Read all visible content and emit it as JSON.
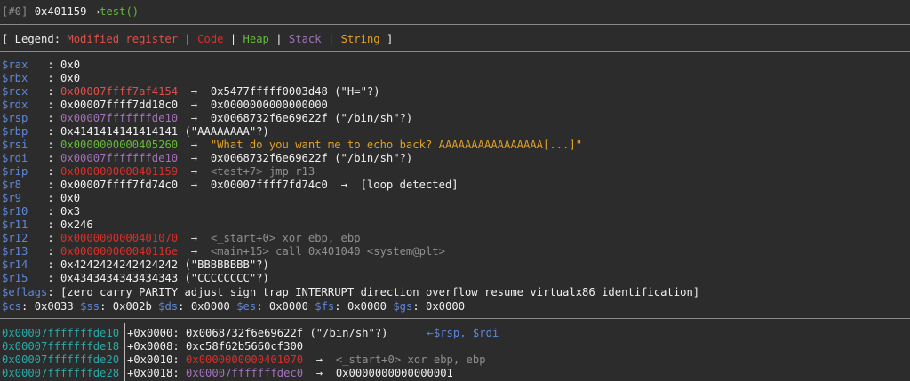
{
  "header": {
    "frame": "[#0]",
    "address": "0x401159",
    "arrow": "→",
    "func": "test()"
  },
  "legend": {
    "open": "[ Legend: ",
    "modified": "Modified register",
    "sep": " | ",
    "code": "Code",
    "heap": "Heap",
    "stack": "Stack",
    "string": "String",
    "close": " ]"
  },
  "registers": [
    {
      "name": "$rax",
      "colon": "   : ",
      "val": "0x0",
      "vclass": "w",
      "arrow1": "",
      "target": "",
      "tclass": "w",
      "extra": ""
    },
    {
      "name": "$rbx",
      "colon": "   : ",
      "val": "0x0",
      "vclass": "w",
      "arrow1": "",
      "target": "",
      "tclass": "w",
      "extra": ""
    },
    {
      "name": "$rcx",
      "colon": "   : ",
      "val": "0x00007ffff7af4154",
      "vclass": "red",
      "arrow1": "  →  ",
      "target": "0x5477fffff0003d48 (\"H=\"?)",
      "tclass": "w",
      "extra": ""
    },
    {
      "name": "$rdx",
      "colon": "   : ",
      "val": "0x00007ffff7dd18c0",
      "vclass": "w",
      "arrow1": "  →  ",
      "target": "0x0000000000000000",
      "tclass": "w",
      "extra": ""
    },
    {
      "name": "$rsp",
      "colon": "   : ",
      "val": "0x00007fffffffde10",
      "vclass": "purple",
      "arrow1": "  →  ",
      "target": "0x0068732f6e69622f (\"/bin/sh\"?)",
      "tclass": "w",
      "extra": ""
    },
    {
      "name": "$rbp",
      "colon": "   : ",
      "val": "0x4141414141414141 (\"AAAAAAAA\"?)",
      "vclass": "w",
      "arrow1": "",
      "target": "",
      "tclass": "w",
      "extra": ""
    },
    {
      "name": "$rsi",
      "colon": "   : ",
      "val": "0x0000000000405260",
      "vclass": "heap",
      "arrow1": "  →  ",
      "target": "\"What do you want me to echo back? AAAAAAAAAAAAAAAA[...]\"",
      "tclass": "string",
      "extra": ""
    },
    {
      "name": "$rdi",
      "colon": "   : ",
      "val": "0x00007fffffffde10",
      "vclass": "purple",
      "arrow1": "  →  ",
      "target": "0x0068732f6e69622f (\"/bin/sh\"?)",
      "tclass": "w",
      "extra": ""
    },
    {
      "name": "$rip",
      "colon": "   : ",
      "val": "0x0000000000401159",
      "vclass": "code",
      "arrow1": "  →  ",
      "target": "<test+7> jmp r13",
      "tclass": "gray",
      "extra": ""
    },
    {
      "name": "$r8",
      "colon": "    : ",
      "val": "0x00007ffff7fd74c0",
      "vclass": "w",
      "arrow1": "  →  ",
      "target": "0x00007ffff7fd74c0",
      "tclass": "w",
      "extra": "  →  [loop detected]"
    },
    {
      "name": "$r9",
      "colon": "    : ",
      "val": "0x0",
      "vclass": "w",
      "arrow1": "",
      "target": "",
      "tclass": "w",
      "extra": ""
    },
    {
      "name": "$r10",
      "colon": "   : ",
      "val": "0x3",
      "vclass": "w",
      "arrow1": "",
      "target": "",
      "tclass": "w",
      "extra": ""
    },
    {
      "name": "$r11",
      "colon": "   : ",
      "val": "0x246",
      "vclass": "w",
      "arrow1": "",
      "target": "",
      "tclass": "w",
      "extra": ""
    },
    {
      "name": "$r12",
      "colon": "   : ",
      "val": "0x0000000000401070",
      "vclass": "code",
      "arrow1": "  →  ",
      "target": "<_start+0> xor ebp, ebp",
      "tclass": "gray",
      "extra": ""
    },
    {
      "name": "$r13",
      "colon": "   : ",
      "val": "0x000000000040116e",
      "vclass": "code",
      "arrow1": "  →  ",
      "target": "<main+15> call 0x401040 <system@plt>",
      "tclass": "gray",
      "extra": ""
    },
    {
      "name": "$r14",
      "colon": "   : ",
      "val": "0x4242424242424242 (\"BBBBBBBB\"?)",
      "vclass": "w",
      "arrow1": "",
      "target": "",
      "tclass": "w",
      "extra": ""
    },
    {
      "name": "$r15",
      "colon": "   : ",
      "val": "0x4343434343434343 (\"CCCCCCCC\"?)",
      "vclass": "w",
      "arrow1": "",
      "target": "",
      "tclass": "w",
      "extra": ""
    }
  ],
  "eflags": {
    "name": "$eflags",
    "value": ": [zero carry PARITY adjust sign trap INTERRUPT direction overflow resume virtualx86 identification]"
  },
  "segments": [
    {
      "name": "$cs",
      "val": ": 0x0033 "
    },
    {
      "name": "$ss",
      "val": ": 0x002b "
    },
    {
      "name": "$ds",
      "val": ": 0x0000 "
    },
    {
      "name": "$es",
      "val": ": 0x0000 "
    },
    {
      "name": "$fs",
      "val": ": 0x0000 "
    },
    {
      "name": "$gs",
      "val": ": 0x0000"
    }
  ],
  "stack": [
    {
      "addr": "0x00007fffffffde10",
      "offset": "+0x0000: ",
      "val": "0x0068732f6e69622f (\"/bin/sh\"?)",
      "vclass": "w",
      "arrow": "",
      "target": "",
      "note": "      ←$rsp, $rdi"
    },
    {
      "addr": "0x00007fffffffde18",
      "offset": "+0x0008: ",
      "val": "0xc58f62b5660cf300",
      "vclass": "w",
      "arrow": "",
      "target": "",
      "note": ""
    },
    {
      "addr": "0x00007fffffffde20",
      "offset": "+0x0010: ",
      "val": "0x0000000000401070",
      "vclass": "code",
      "arrow": "  →  ",
      "target": "<_start+0> xor ebp, ebp",
      "note": ""
    },
    {
      "addr": "0x00007fffffffde28",
      "offset": "+0x0018: ",
      "val": "0x00007fffffffdec0",
      "vclass": "purple",
      "arrow": "  →  ",
      "target": "0x0000000000000001",
      "note": ""
    }
  ]
}
